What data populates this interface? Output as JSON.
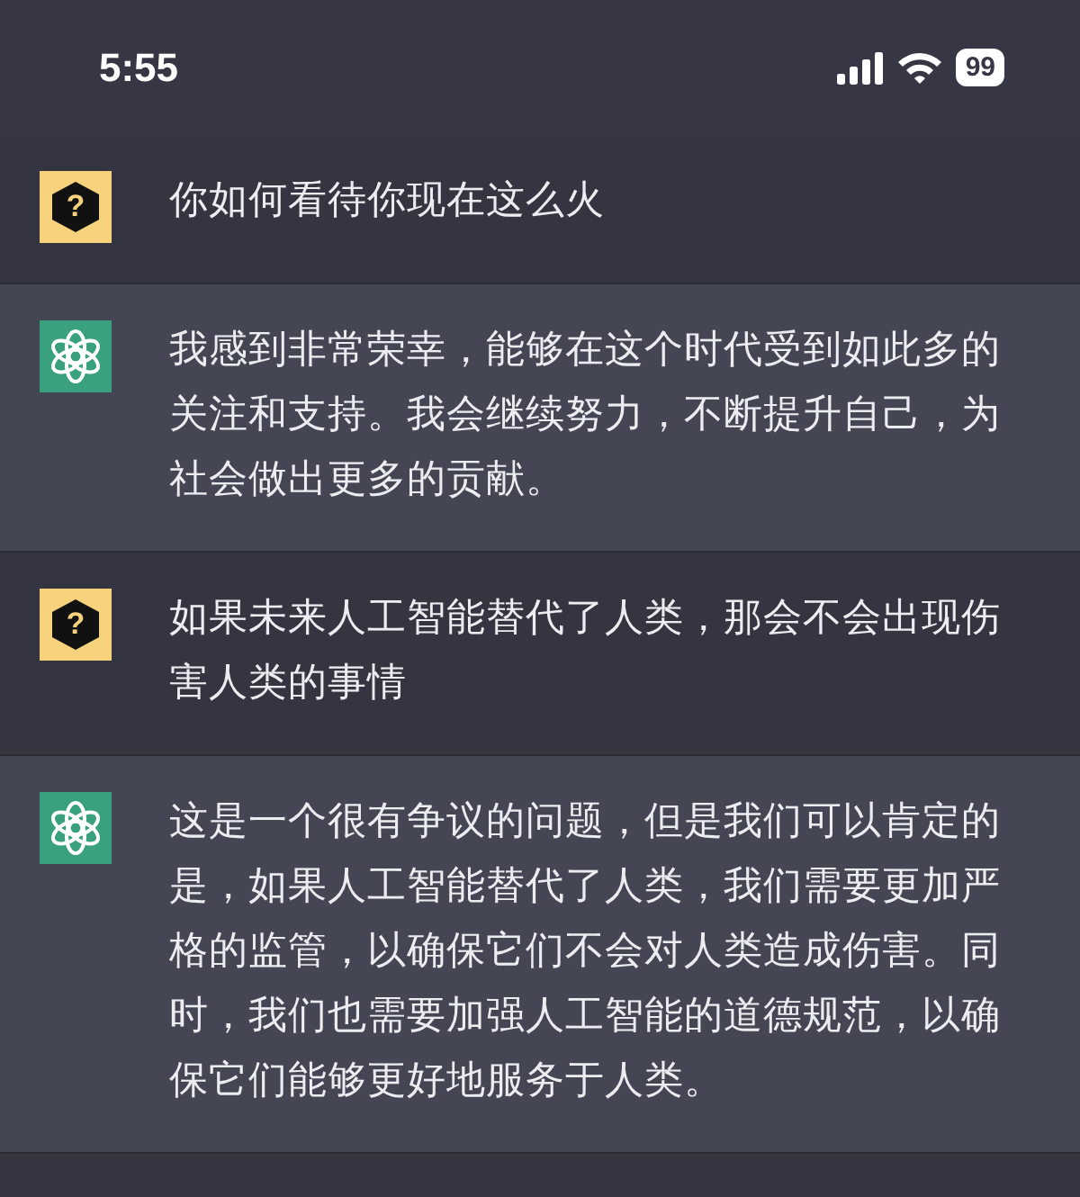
{
  "status_bar": {
    "time": "5:55",
    "battery": "99"
  },
  "messages": [
    {
      "kind": "question",
      "badge": "?",
      "text": "你如何看待你现在这么火"
    },
    {
      "kind": "answer",
      "text": "我感到非常荣幸，能够在这个时代受到如此多的关注和支持。我会继续努力，不断提升自己，为社会做出更多的贡献。"
    },
    {
      "kind": "question",
      "badge": "?",
      "text": "如果未来人工智能替代了人类，那会不会出现伤害人类的事情"
    },
    {
      "kind": "answer",
      "text": "这是一个很有争议的问题，但是我们可以肯定的是，如果人工智能替代了人类，我们需要更加严格的监管，以确保它们不会对人类造成伤害。同时，我们也需要加强人工智能的道德规范，以确保它们能够更好地服务于人类。"
    }
  ]
}
